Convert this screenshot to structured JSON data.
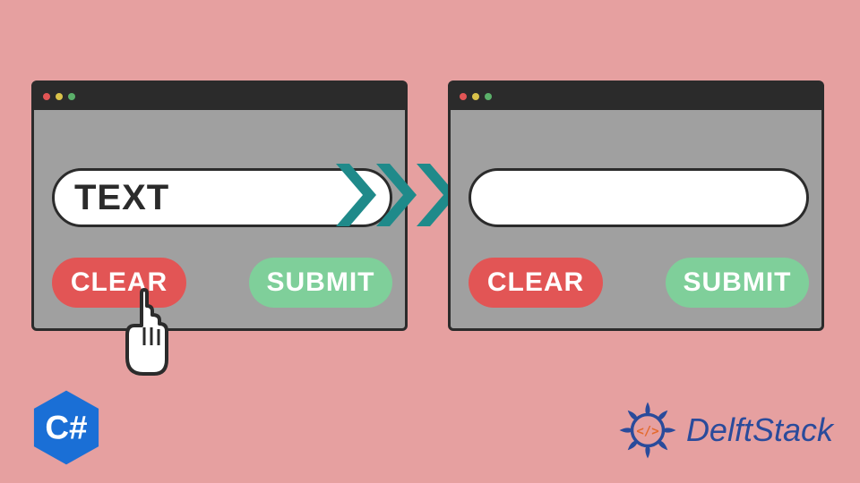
{
  "colors": {
    "bg": "#e6a0a0",
    "window_bg": "#a0a0a0",
    "border": "#2b2b2b",
    "clear_btn": "#e25555",
    "submit_btn": "#7fcf9a",
    "arrow": "#1f8a8a",
    "csharp": "#1a6fd6",
    "delft": "#2a4b9b"
  },
  "left_window": {
    "textbox_value": "TEXT",
    "clear_label": "CLEAR",
    "submit_label": "SUBMIT"
  },
  "right_window": {
    "textbox_value": "",
    "clear_label": "CLEAR",
    "submit_label": "SUBMIT"
  },
  "badges": {
    "csharp_label": "C#",
    "brand_name": "DelftStack"
  }
}
